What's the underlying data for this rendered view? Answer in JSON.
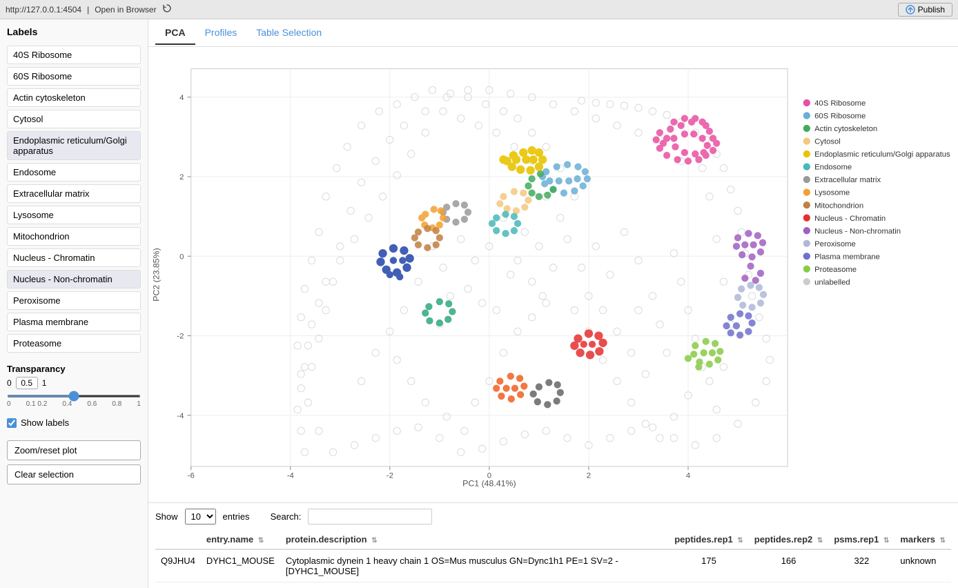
{
  "topbar": {
    "url": "http://127.0.0.1:4504",
    "open_in_browser": "Open in Browser",
    "publish_label": "Publish"
  },
  "tabs": [
    {
      "id": "pca",
      "label": "PCA",
      "active": true
    },
    {
      "id": "profiles",
      "label": "Profiles",
      "active": false
    },
    {
      "id": "table_selection",
      "label": "Table Selection",
      "active": false
    }
  ],
  "sidebar": {
    "labels_title": "Labels",
    "labels": [
      {
        "id": "40s_ribosome",
        "text": "40S Ribosome",
        "selected": false
      },
      {
        "id": "60s_ribosome",
        "text": "60S Ribosome",
        "selected": false
      },
      {
        "id": "actin_cytoskeleton",
        "text": "Actin cytoskeleton",
        "selected": false
      },
      {
        "id": "cytosol",
        "text": "Cytosol",
        "selected": false
      },
      {
        "id": "er_golgi",
        "text": "Endoplasmic reticulum/Golgi apparatus",
        "selected": true
      },
      {
        "id": "endosome",
        "text": "Endosome",
        "selected": false
      },
      {
        "id": "extracellular_matrix",
        "text": "Extracellular matrix",
        "selected": false
      },
      {
        "id": "lysosome",
        "text": "Lysosome",
        "selected": false
      },
      {
        "id": "mitochondrion",
        "text": "Mitochondrion",
        "selected": false
      },
      {
        "id": "nucleus_chromatin",
        "text": "Nucleus - Chromatin",
        "selected": false
      },
      {
        "id": "nucleus_non_chromatin",
        "text": "Nucleus - Non-chromatin",
        "selected": true
      },
      {
        "id": "peroxisome",
        "text": "Peroxisome",
        "selected": false
      },
      {
        "id": "plasma_membrane",
        "text": "Plasma membrane",
        "selected": false
      },
      {
        "id": "proteasome",
        "text": "Proteasome",
        "selected": false
      }
    ],
    "transparency_title": "Transparancy",
    "transparency_min": "0",
    "transparency_value": "0.5",
    "transparency_max": "1",
    "transparency_ticks": [
      "0",
      "0.10.2",
      "0.4",
      "0.6",
      "0.8",
      "1"
    ],
    "show_labels_text": "Show labels",
    "show_labels_checked": true,
    "zoom_reset_label": "Zoom/reset plot",
    "clear_selection_label": "Clear selection"
  },
  "legend": {
    "items": [
      {
        "label": "40S Ribosome",
        "color": "#e94fa0"
      },
      {
        "label": "60S Ribosome",
        "color": "#6baed6"
      },
      {
        "label": "Actin cytoskeleton",
        "color": "#41ab5d"
      },
      {
        "label": "Cytosol",
        "color": "#f0c890"
      },
      {
        "label": "Endoplasmic reticulum/Golgi apparatus",
        "color": "#e8c400"
      },
      {
        "label": "Endosome",
        "color": "#74c5c5"
      },
      {
        "label": "Extracellular matrix",
        "color": "#9e9e9e"
      },
      {
        "label": "Lysosome",
        "color": "#f4a460"
      },
      {
        "label": "Mitochondrion",
        "color": "#c0a080"
      },
      {
        "label": "Nucleus - Chromatin",
        "color": "#ff6666"
      },
      {
        "label": "Nucleus - Non-chromatin",
        "color": "#c084c8"
      },
      {
        "label": "Peroxisome",
        "color": "#b0c0d0"
      },
      {
        "label": "Plasma membrane",
        "color": "#8888cc"
      },
      {
        "label": "Proteasome",
        "color": "#a8d870"
      },
      {
        "label": "unlabelled",
        "color": "#cccccc"
      }
    ]
  },
  "plot": {
    "x_label": "PC1 (48.41%)",
    "y_label": "PC2 (23.85%)",
    "x_axis_ticks": [
      "-6",
      "-4",
      "-2",
      "0",
      "2",
      "4"
    ],
    "y_axis_ticks": [
      "4",
      "2",
      "0",
      "-2",
      "-4"
    ]
  },
  "table": {
    "show_label": "Show",
    "entries_label": "entries",
    "search_placeholder": "",
    "search_label": "Search:",
    "show_value": "10",
    "columns": [
      {
        "id": "entry_name",
        "label": "entry.name"
      },
      {
        "id": "protein_description",
        "label": "protein.description"
      },
      {
        "id": "peptides_rep1",
        "label": "peptides.rep1"
      },
      {
        "id": "peptides_rep2",
        "label": "peptides.rep2"
      },
      {
        "id": "psms_rep1",
        "label": "psms.rep1"
      },
      {
        "id": "markers",
        "label": "markers"
      }
    ],
    "rows": [
      {
        "id": "Q9JHU4",
        "entry_name": "DYHC1_MOUSE",
        "protein_description": "Cytoplasmic dynein 1 heavy chain 1 OS=Mus musculus GN=Dync1h1 PE=1 SV=2 - [DYHC1_MOUSE]",
        "peptides_rep1": "175",
        "peptides_rep2": "166",
        "psms_rep1": "322",
        "markers": "unknown"
      }
    ]
  }
}
